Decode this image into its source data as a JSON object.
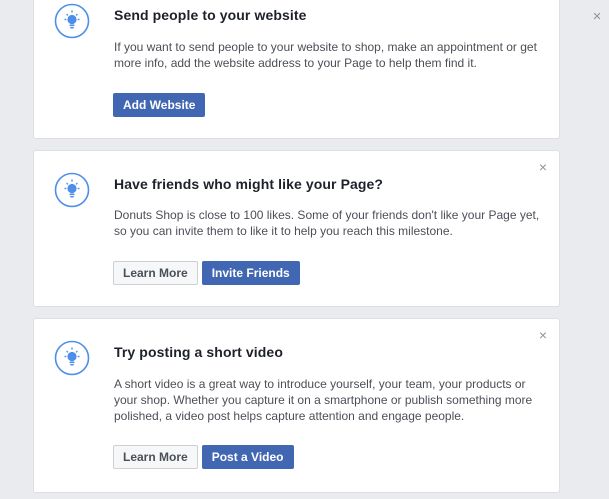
{
  "colors": {
    "accent": "#4267b2",
    "page_background": "#e9ebee",
    "card_background": "#ffffff",
    "icon": "#4c8ee8"
  },
  "page_close_symbol": "×",
  "cards": [
    {
      "icon": "lightbulb-icon",
      "title": "Send people to your website",
      "body": "If you want to send people to your website to shop, make an appointment or get more info, add the website address to your Page to help them find it.",
      "close_symbol": "×",
      "buttons": [
        {
          "label": "Add Website",
          "style": "primary"
        }
      ]
    },
    {
      "icon": "lightbulb-icon",
      "title": "Have friends who might like your Page?",
      "body": "Donuts Shop is close to 100 likes. Some of your friends don't like your Page yet, so you can invite them to like it to help you reach this milestone.",
      "close_symbol": "×",
      "buttons": [
        {
          "label": "Learn More",
          "style": "secondary"
        },
        {
          "label": "Invite Friends",
          "style": "primary"
        }
      ]
    },
    {
      "icon": "lightbulb-icon",
      "title": "Try posting a short video",
      "body": "A short video is a great way to introduce yourself, your team, your products or your shop. Whether you capture it on a smartphone or publish something more polished, a video post helps capture attention and engage people.",
      "close_symbol": "×",
      "buttons": [
        {
          "label": "Learn More",
          "style": "secondary"
        },
        {
          "label": "Post a Video",
          "style": "primary"
        }
      ]
    }
  ]
}
